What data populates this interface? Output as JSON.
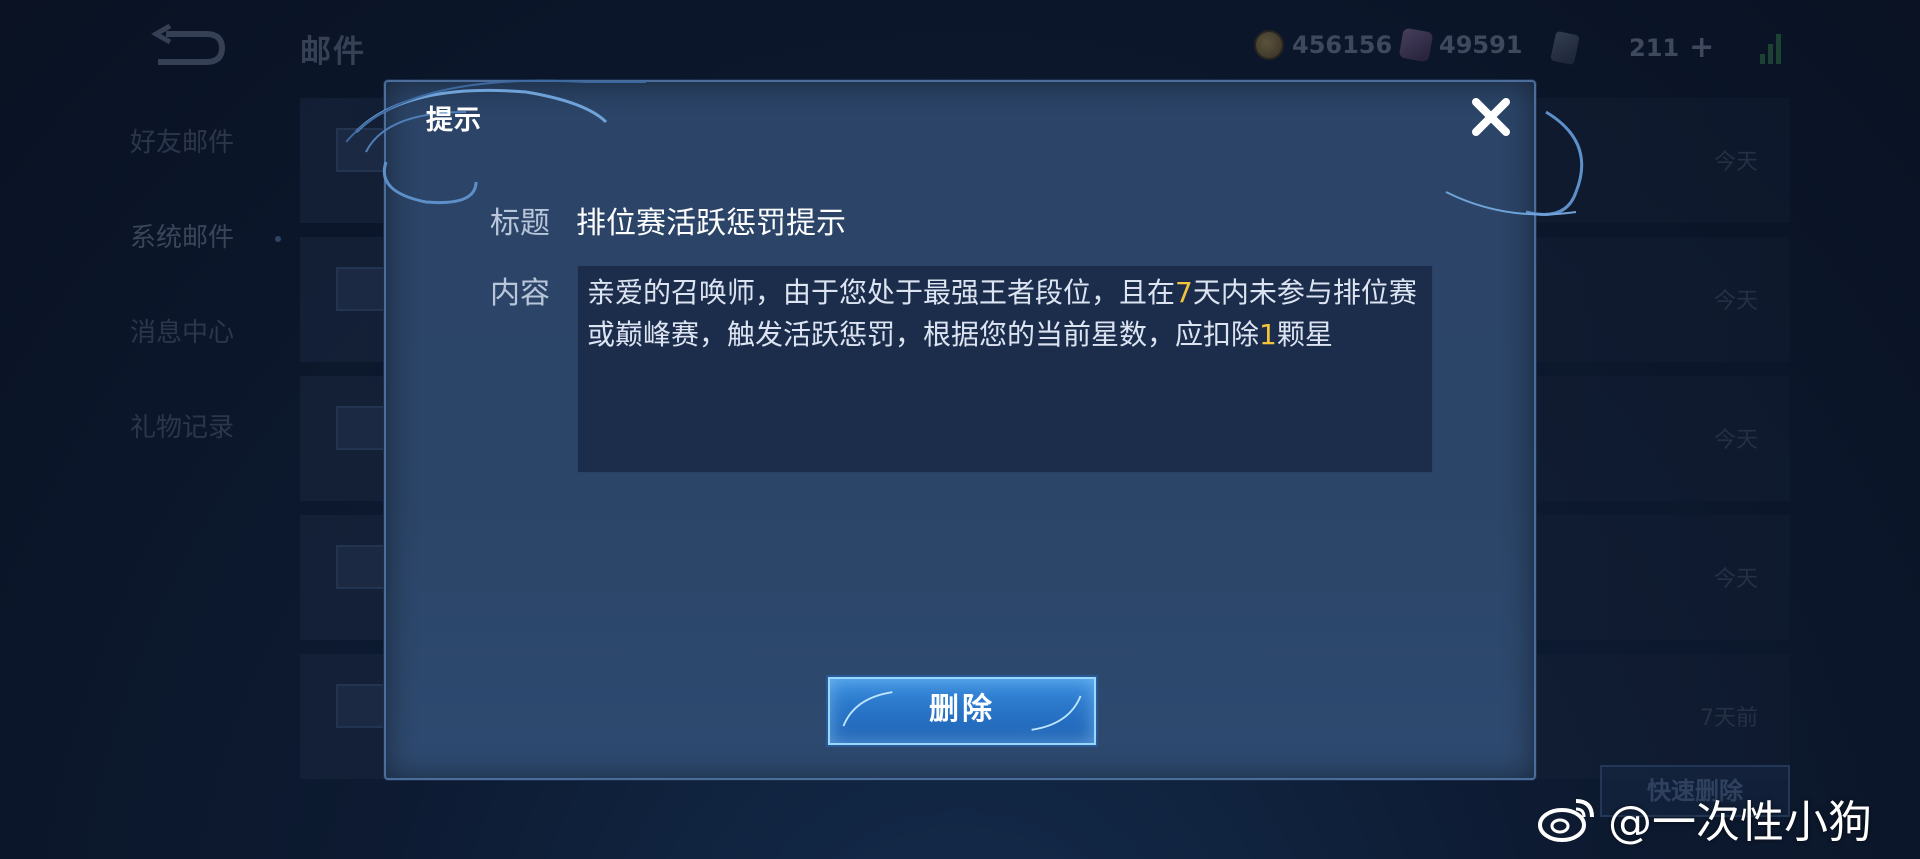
{
  "header": {
    "title": "邮件",
    "currencies": [
      {
        "icon": "coin-icon",
        "value": "456156"
      },
      {
        "icon": "gem-icon",
        "value": "49591"
      },
      {
        "icon": "ticket-icon",
        "value": "211"
      }
    ]
  },
  "sidebar": {
    "items": [
      {
        "label": "好友邮件"
      },
      {
        "label": "系统邮件"
      },
      {
        "label": "消息中心"
      },
      {
        "label": "礼物记录"
      }
    ]
  },
  "mail_list": {
    "rows": [
      {
        "when": "今天"
      },
      {
        "when": "今天"
      },
      {
        "when": "今天"
      },
      {
        "when": "今天"
      },
      {
        "when": "7天前"
      }
    ],
    "quick_delete_label": "快速删除"
  },
  "dialog": {
    "title": "提示",
    "title_label": "标题",
    "title_value": "排位赛活跃惩罚提示",
    "content_label": "内容",
    "content_part1": "亲爱的召唤师，由于您处于最强王者段位，且在",
    "content_days": "7",
    "content_part2": "天内未参与排位赛或巅峰赛，触发活跃惩罚，根据您的当前星数，应扣除",
    "content_stars": "1",
    "content_part3": "颗星",
    "delete_label": "删除"
  },
  "watermark": {
    "text": "@一次性小狗"
  },
  "colors": {
    "highlight": "#f2c33b",
    "button": "#2a76c9",
    "dialog_bg": "#2b4467"
  }
}
